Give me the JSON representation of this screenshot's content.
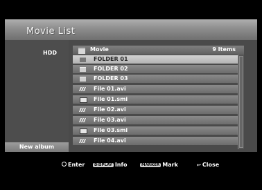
{
  "title": "Movie List",
  "left_panel": {
    "hdd_label": "HDD",
    "new_album_label": "New album"
  },
  "list": {
    "header_name": "Movie",
    "item_count": "9 Items",
    "items": [
      {
        "type": "folder",
        "icon": "folder-icon",
        "label": "FOLDER 01",
        "selected": true
      },
      {
        "type": "folder",
        "icon": "folder-icon",
        "label": "FOLDER 02",
        "selected": false
      },
      {
        "type": "folder",
        "icon": "folder-icon",
        "label": "FOLDER 03",
        "selected": false
      },
      {
        "type": "movie",
        "icon": "clapperboard-icon",
        "label": "File 01.avi",
        "selected": false
      },
      {
        "type": "subtitle",
        "icon": "subtitle-icon",
        "label": "File 01.smi",
        "selected": false
      },
      {
        "type": "movie",
        "icon": "clapperboard-icon",
        "label": "File 02.avi",
        "selected": false
      },
      {
        "type": "movie",
        "icon": "clapperboard-icon",
        "label": "File 03.avi",
        "selected": false
      },
      {
        "type": "subtitle",
        "icon": "subtitle-icon",
        "label": "File 03.smi",
        "selected": false
      },
      {
        "type": "movie",
        "icon": "clapperboard-icon",
        "label": "File 04.avi",
        "selected": false
      }
    ]
  },
  "footer": {
    "enter_label": "Enter",
    "display_key": "DISPLAY",
    "info_label": "Info",
    "marker_key": "MARKER",
    "mark_label": "Mark",
    "close_label": "Close"
  }
}
